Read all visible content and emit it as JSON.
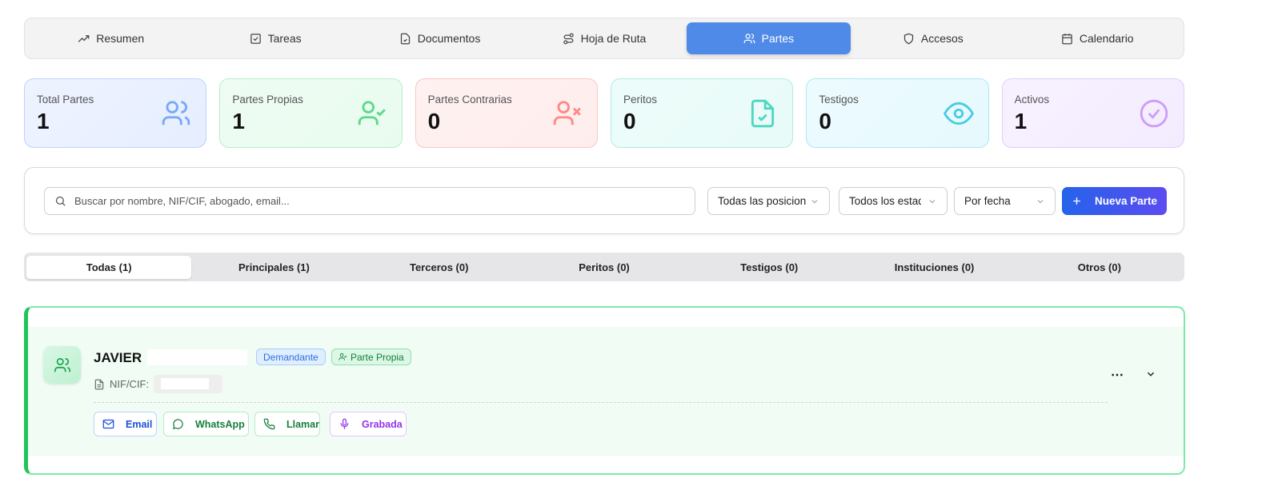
{
  "nav": {
    "tabs": [
      {
        "label": "Resumen",
        "icon": "trending-up-icon"
      },
      {
        "label": "Tareas",
        "icon": "checkbox-icon"
      },
      {
        "label": "Documentos",
        "icon": "file-check-icon"
      },
      {
        "label": "Hoja de Ruta",
        "icon": "route-icon"
      },
      {
        "label": "Partes",
        "icon": "users-icon",
        "active": true
      },
      {
        "label": "Accesos",
        "icon": "shield-icon"
      },
      {
        "label": "Calendario",
        "icon": "calendar-icon"
      }
    ]
  },
  "stats": [
    {
      "label": "Total Partes",
      "value": "1",
      "icon": "users-icon",
      "color": "#3b82f6"
    },
    {
      "label": "Partes Propias",
      "value": "1",
      "icon": "user-check-icon",
      "color": "#22c55e"
    },
    {
      "label": "Partes Contrarias",
      "value": "0",
      "icon": "user-x-icon",
      "color": "#f87171"
    },
    {
      "label": "Peritos",
      "value": "0",
      "icon": "file-check-icon",
      "color": "#2dd4bf"
    },
    {
      "label": "Testigos",
      "value": "0",
      "icon": "eye-icon",
      "color": "#22d3ee"
    },
    {
      "label": "Activos",
      "value": "1",
      "icon": "circle-check-icon",
      "color": "#c084fc"
    }
  ],
  "filters": {
    "search_placeholder": "Buscar por nombre, NIF/CIF, abogado, email...",
    "position": "Todas las posiciones",
    "status": "Todos los estados",
    "sort": "Por fecha",
    "new_button": "Nueva Parte"
  },
  "subtabs": [
    {
      "label": "Todas (1)",
      "active": true
    },
    {
      "label": "Principales (1)"
    },
    {
      "label": "Terceros (0)"
    },
    {
      "label": "Peritos (0)"
    },
    {
      "label": "Testigos (0)"
    },
    {
      "label": "Instituciones (0)"
    },
    {
      "label": "Otros (0)"
    }
  ],
  "party": {
    "name": "JAVIER",
    "role_badge": "Demandante",
    "type_badge": "Parte Propia",
    "nif_label": "NIF/CIF:",
    "more": "⋯",
    "actions": [
      {
        "label": "Email",
        "icon": "mail-icon",
        "color": "#1d4ed8"
      },
      {
        "label": "WhatsApp",
        "icon": "message-circle-icon",
        "color": "#15803d"
      },
      {
        "label": "Llamar",
        "icon": "phone-icon",
        "color": "#15803d"
      },
      {
        "label": "Grabada",
        "icon": "mic-icon",
        "color": "#9333ea"
      }
    ]
  }
}
